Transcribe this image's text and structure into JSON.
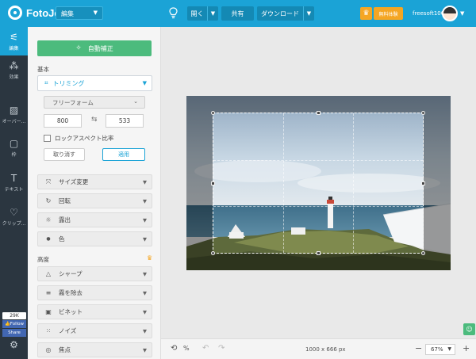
{
  "app": {
    "logo_text": "FotoJet",
    "mode_select": "編集",
    "open_label": "開く",
    "share_label": "共有",
    "download_label": "ダウンロード",
    "trial_label": "無料体験",
    "username": "freesoft100"
  },
  "rail": [
    {
      "label": "編集",
      "icon": "sliders-icon",
      "glyph": "⚟",
      "active": true
    },
    {
      "label": "効果",
      "icon": "magic-wand-icon",
      "glyph": "⁂",
      "active": false
    },
    {
      "label": "オーバー...",
      "icon": "overlay-icon",
      "glyph": "▨",
      "active": false
    },
    {
      "label": "枠",
      "icon": "frame-icon",
      "glyph": "▢",
      "active": false
    },
    {
      "label": "テキスト",
      "icon": "text-icon",
      "glyph": "T",
      "active": false
    },
    {
      "label": "クリップ...",
      "icon": "heart-icon",
      "glyph": "♡",
      "active": false
    }
  ],
  "facebook": {
    "count": "29K",
    "follow": "Follow",
    "share": "Share"
  },
  "panel": {
    "auto_fix": "自動補正",
    "basic_label": "基本",
    "crop_tool": "トリミング",
    "ratio": "フリーフォーム",
    "width": "800",
    "height": "533",
    "lock_aspect": "ロックアスペクト比率",
    "cancel": "取り消す",
    "apply": "適用",
    "basic_tools": [
      {
        "label": "サイズ変更",
        "icon": "resize-icon",
        "glyph": "⤧"
      },
      {
        "label": "回転",
        "icon": "rotate-icon",
        "glyph": "↻"
      },
      {
        "label": "露出",
        "icon": "exposure-icon",
        "glyph": "☼"
      },
      {
        "label": "色",
        "icon": "color-drop-icon",
        "glyph": "●"
      }
    ],
    "advanced_label": "高度",
    "advanced_tools": [
      {
        "label": "シャープ",
        "icon": "sharpen-icon",
        "glyph": "△"
      },
      {
        "label": "霧を除去",
        "icon": "dehaze-icon",
        "glyph": "≡"
      },
      {
        "label": "ビネット",
        "icon": "vignette-icon",
        "glyph": "▣"
      },
      {
        "label": "ノイズ",
        "icon": "noise-icon",
        "glyph": "⁙"
      },
      {
        "label": "焦点",
        "icon": "focus-icon",
        "glyph": "◎"
      }
    ]
  },
  "canvas": {
    "image_size": "1000 x 666 px",
    "zoom": "67%"
  },
  "colors": {
    "accent": "#1ba3d6",
    "rail_bg": "#2b3640",
    "green": "#4cbb7d",
    "orange": "#f5a623"
  }
}
